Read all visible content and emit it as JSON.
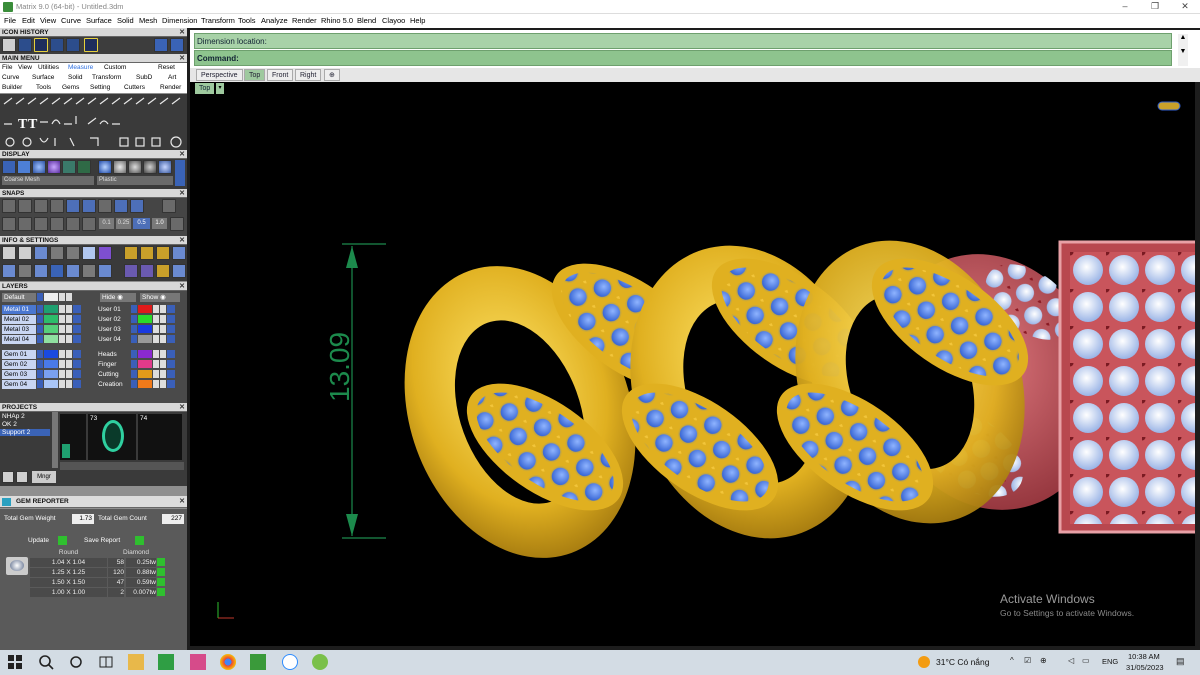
{
  "window": {
    "title": "Matrix 9.0 (64-bit) - Untitled.3dm",
    "controls": {
      "minimize": "–",
      "maximize": "❐",
      "close": "✕"
    }
  },
  "menubar": [
    "File",
    "Edit",
    "View",
    "Curve",
    "Surface",
    "Solid",
    "Mesh",
    "Dimension",
    "Transform",
    "Tools",
    "Analyze",
    "Render",
    "Rhino 5.0",
    "Blend",
    "Clayoo",
    "Help"
  ],
  "left_panel": {
    "icon_history": {
      "title": "ICON HISTORY"
    },
    "main_menu": {
      "title": "MAIN MENU",
      "top_row": [
        "File",
        "View",
        "Utilities",
        "Measure",
        "Custom",
        "Reset"
      ],
      "row1": [
        "Curve",
        "Surface",
        "Solid",
        "Transform",
        "SubD",
        "Art"
      ],
      "row2": [
        "Builder",
        "Tools",
        "Gems",
        "Setting",
        "Cutters",
        "Render"
      ]
    },
    "display": {
      "title": "DISPLAY",
      "left_select": "Coarse Mesh",
      "right_select": "Plastic"
    },
    "snaps": {
      "title": "SNAPS",
      "values": [
        "0.1",
        "0.25",
        "0.5",
        "1.0"
      ]
    },
    "info_settings": {
      "title": "INFO & SETTINGS"
    },
    "layers": {
      "title": "LAYERS",
      "top_left": "Default",
      "hide_label": "Hide",
      "show_label": "Show",
      "left_group1": [
        "Metal 01",
        "Metal 02",
        "Metal 03",
        "Metal 04"
      ],
      "left_group2": [
        "Gem 01",
        "Gem 02",
        "Gem 03",
        "Gem 04"
      ],
      "right_group1": [
        "User 01",
        "User 02",
        "User 03",
        "User 04"
      ],
      "right_group2": [
        "Heads",
        "Finger",
        "Cutting",
        "Creation"
      ]
    },
    "projects": {
      "title": "PROJECTS",
      "list": [
        "NHAp 2",
        "OK 2",
        "Support 2"
      ],
      "thumb_numbers": [
        "73",
        "74"
      ],
      "manage_label": "Mngr"
    },
    "gem_reporter": {
      "title": "GEM REPORTER",
      "total_weight_label": "Total Gem Weight",
      "total_weight": "1.73",
      "total_count_label": "Total Gem Count",
      "total_count": "227",
      "update_label": "Update",
      "save_label": "Save Report",
      "shape_header": "Round",
      "type_header": "Diamond",
      "rows": [
        {
          "size": "1.04 X 1.04",
          "count": "58",
          "weight": "0.25tw"
        },
        {
          "size": "1.25 X 1.25",
          "count": "120",
          "weight": "0.88tw"
        },
        {
          "size": "1.50 X 1.50",
          "count": "47",
          "weight": "0.59tw"
        },
        {
          "size": "1.00 X 1.00",
          "count": "2",
          "weight": "0.007tw"
        }
      ]
    }
  },
  "command": {
    "dimension_label": "Dimension location:",
    "command_label": "Command:"
  },
  "viewport_tabs": [
    "Perspective",
    "Top",
    "Front",
    "Right",
    "⊕"
  ],
  "viewport": {
    "label": "Top",
    "dimension_value": "13.09",
    "watermark_title": "Activate Windows",
    "watermark_sub": "Go to Settings to activate Windows."
  },
  "taskbar": {
    "weather": "31°C  Có nắng",
    "lang": "ENG",
    "time": "10:38 AM",
    "date": "31/05/2023"
  },
  "colors": {
    "gold": "#e0b020",
    "gem_blue": "#3f6fd8",
    "rose": "#b8474f",
    "dim_green": "#1c8a4c",
    "cmd_green": "#8ec48e"
  }
}
